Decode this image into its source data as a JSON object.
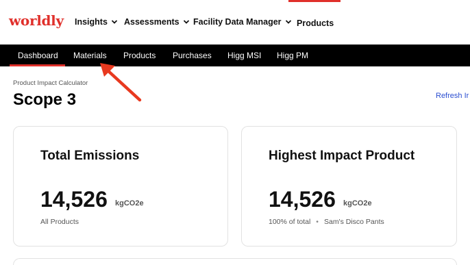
{
  "brand": {
    "logo_text": "worldly",
    "accent": "#e0302b"
  },
  "top_nav": {
    "items": [
      {
        "label": "Insights",
        "has_dropdown": true
      },
      {
        "label": "Assessments",
        "has_dropdown": true
      },
      {
        "label": "Facility Data Manager",
        "has_dropdown": true
      },
      {
        "label": "Products",
        "has_dropdown": false,
        "active": true
      }
    ]
  },
  "sub_nav": {
    "items": [
      {
        "label": "Dashboard",
        "active": true
      },
      {
        "label": "Materials"
      },
      {
        "label": "Products"
      },
      {
        "label": "Purchases"
      },
      {
        "label": "Higg MSI"
      },
      {
        "label": "Higg PM"
      }
    ]
  },
  "page": {
    "eyebrow": "Product Impact Calculator",
    "title": "Scope 3",
    "refresh_link": "Refresh Ir"
  },
  "cards": [
    {
      "title": "Total Emissions",
      "value": "14,526",
      "unit": "kgCO2e",
      "subtitle": "All Products"
    },
    {
      "title": "Highest Impact Product",
      "value": "14,526",
      "unit": "kgCO2e",
      "subtitle_percent": "100% of total",
      "subtitle_separator": "•",
      "subtitle_product": "Sam's Disco Pants"
    }
  ],
  "annotation": {
    "icon": "red-arrow-icon",
    "color": "#e8391f"
  }
}
